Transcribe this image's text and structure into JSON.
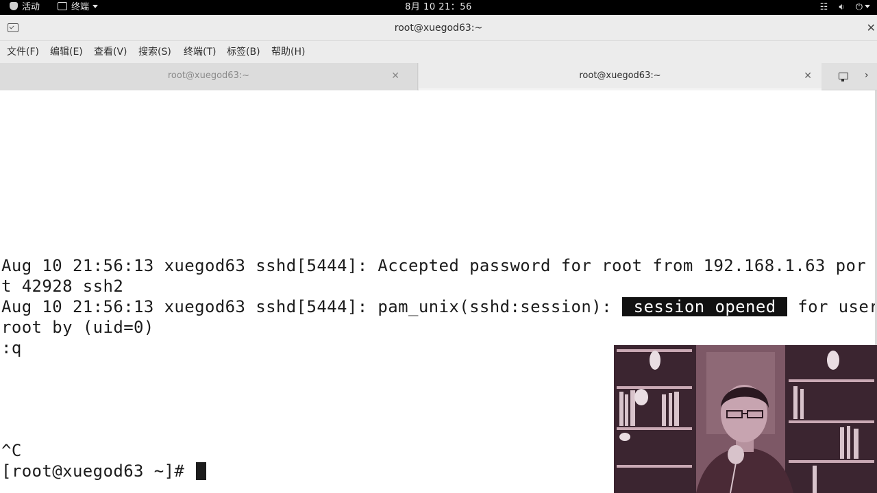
{
  "topbar": {
    "activities": "活动",
    "app_name": "终端",
    "clock": "8月 10 21：56"
  },
  "window": {
    "title": "root@xuegod63:~"
  },
  "menu": {
    "items": [
      "文件(F)",
      "编辑(E)",
      "查看(V)",
      "搜索(S)",
      "终端(T)",
      "标签(B)",
      "帮助(H)"
    ]
  },
  "tabs": [
    {
      "label": "root@xuegod63:~",
      "active": false
    },
    {
      "label": "root@xuegod63:~",
      "active": true
    }
  ],
  "terminal": {
    "lines": [
      "Aug 10 21:56:13 xuegod63 sshd[5444]: Accepted password for root from 192.168.1.63 por",
      "t 42928 ssh2",
      "Aug 10 21:56:13 xuegod63 sshd[5444]: pam_unix(sshd:session):",
      "root by (uid=0)",
      ":q",
      "^C",
      "[root@xuegod63 ~]# "
    ],
    "highlight": "session opened",
    "line3_tail": "for user"
  },
  "icons": {
    "activities": "gnome-foot-icon",
    "app": "terminal-icon",
    "network": "network-icon",
    "volume": "volume-icon",
    "power": "power-icon",
    "new_tab": "new-tab-icon"
  }
}
